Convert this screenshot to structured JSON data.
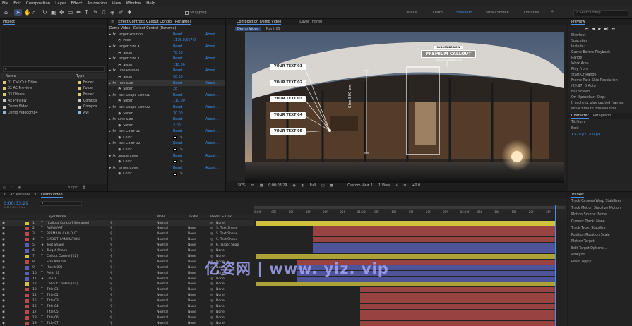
{
  "menu": [
    "File",
    "Edit",
    "Composition",
    "Layer",
    "Effect",
    "Animation",
    "View",
    "Window",
    "Help"
  ],
  "toolbar": {
    "snapping_label": "Snapping",
    "workspaces": [
      "Default",
      "Learn",
      "Standard",
      "Small Screen",
      "Libraries"
    ],
    "active_workspace": "Standard",
    "search_placeholder": "Search Help"
  },
  "project": {
    "tab": "Project",
    "columns": {
      "name": "Name",
      "type": "Type"
    },
    "items": [
      {
        "name": "01 Call Out Titles",
        "type": "Folder",
        "color": "#d9c77a"
      },
      {
        "name": "02 AE Preview",
        "type": "Folder",
        "color": "#d9c77a"
      },
      {
        "name": "03 Others",
        "type": "Folder",
        "color": "#d9c77a"
      },
      {
        "name": "AE Preview",
        "type": "Compos",
        "color": "#c8c8c8"
      },
      {
        "name": "Demo Video",
        "type": "Compos",
        "color": "#c8c8c8"
      },
      {
        "name": "Demo Videocmp4",
        "type": "AVI",
        "color": "#8fb5d6"
      }
    ],
    "footer_label": "8 bpc"
  },
  "effect_controls": {
    "tab": "Effect Controls: Callout Control (Rename)",
    "header": "Demo Video · Callout Control (Rename)",
    "rows": [
      {
        "n": "Target Position",
        "v": "Reset",
        "v2": "About..."
      },
      {
        "n": "Point",
        "v": "1176.0,567.0",
        "v2": ""
      },
      {
        "n": "Target Size X",
        "v": "Reset",
        "v2": "About..."
      },
      {
        "n": "Slider",
        "v": "78.00",
        "v2": ""
      },
      {
        "n": "Target Size Y",
        "v": "Reset",
        "v2": "About..."
      },
      {
        "n": "Slider",
        "v": "118.00",
        "v2": ""
      },
      {
        "n": "Title Position",
        "v": "Reset",
        "v2": "About..."
      },
      {
        "n": "Slider",
        "v": "50.00",
        "v2": ""
      },
      {
        "n": "Title Size",
        "v": "Reset",
        "v2": "About..."
      },
      {
        "n": "Slider",
        "v": "28",
        "v2": ""
      },
      {
        "n": "Text Shape Size 01",
        "v": "Reset",
        "v2": "About..."
      },
      {
        "n": "Slider",
        "v": "110.00",
        "v2": ""
      },
      {
        "n": "Text Shape Size 02",
        "v": "Reset",
        "v2": "About..."
      },
      {
        "n": "Slider",
        "v": "30.00",
        "v2": ""
      },
      {
        "n": "Line Size",
        "v": "Reset",
        "v2": "About..."
      },
      {
        "n": "Slider",
        "v": "3.00",
        "v2": ""
      },
      {
        "n": "Text Color 01",
        "v": "Reset",
        "v2": "About..."
      },
      {
        "n": "Color",
        "v": "",
        "v2": ""
      },
      {
        "n": "Text Color 02",
        "v": "Reset",
        "v2": "About..."
      },
      {
        "n": "Color",
        "v": "",
        "v2": ""
      },
      {
        "n": "Shape Color",
        "v": "Reset",
        "v2": "About..."
      },
      {
        "n": "Color",
        "v": "",
        "v2": ""
      },
      {
        "n": "Target Color",
        "v": "Reset",
        "v2": "About..."
      },
      {
        "n": "Color",
        "v": "",
        "v2": ""
      }
    ]
  },
  "composition": {
    "tab": "Composition Demo Video",
    "layer_tab": "Layer (none)",
    "crumbs": [
      "Demo Video",
      "Point 09"
    ],
    "callouts": [
      "YOUR TEXT 01",
      "YOUR TEXT 02",
      "YOUR TEXT 03",
      "YOUR TEXT 04",
      "YOUR TEXT 05"
    ],
    "premium": {
      "top": "SUBSCRIBE NOW",
      "main": "PREMIUM CALLOUT",
      "sub": "SMOOTH ANIMATION"
    },
    "size_label": "Size 800 cm",
    "footer": {
      "zoom": "50%",
      "timecode": "0;00;03;29",
      "res": "Full",
      "view": "Custom View 1",
      "views": "1 View",
      "exposure": "+0.0"
    }
  },
  "preview": {
    "tab": "Preview",
    "rows": [
      "Shortcut",
      "Spacebar",
      "Include:",
      "Cache Before Playback",
      "Range",
      "Work Area",
      "Play From",
      "Start Of Range",
      "Frame Rate  Skip  Resolution",
      "(29.97)  0  Auto",
      "Full Screen",
      "On (Spacebar) Stop:",
      "If caching, play cached frames",
      "Move time to preview time"
    ]
  },
  "character": {
    "tabs": [
      "Character",
      "Paragraph"
    ],
    "font": "Titillium",
    "style": "Bold",
    "size": "420 px",
    "leading": "200 px"
  },
  "tracker": {
    "tab": "Tracker",
    "rows": [
      "Track Camera   Warp Stabilizer",
      "Track Motion   Stabilize Motion",
      "Motion Source:  None",
      "Current Track:  None",
      "Track Type:  Stabilize",
      "Position   Rotation   Scale",
      "Motion Target:",
      "Edit Target   Options...",
      "Analyze:",
      "Reset   Apply"
    ]
  },
  "timeline": {
    "tabs": [
      "AE Preview",
      "Demo Video"
    ],
    "timecode": "0;00;03;29",
    "timecode_sub": "00119 (29.97 fps)",
    "columns": {
      "layer": "Layer Name",
      "mode": "Mode",
      "trkmat": "T TrkMat",
      "parent": "Parent & Link"
    },
    "ruler": [
      "0:00f",
      "05f",
      "10f",
      "15f",
      "20f",
      "25f",
      "01:00f",
      "05f",
      "10f",
      "15f",
      "20f",
      "25f",
      "02:00f",
      "05f",
      "10f",
      "15f",
      "20f",
      "25f"
    ],
    "layers": [
      {
        "i": "1",
        "name": "[Callout Control] (Rename)",
        "star": false,
        "color": "#d0c23a",
        "parent": "None",
        "mode": "Normal",
        "trk": ""
      },
      {
        "i": "2",
        "name": "AWAWAAT",
        "star": false,
        "color": "#b74a4a",
        "parent": "5. Text Shape",
        "mode": "Normal",
        "trk": "None"
      },
      {
        "i": "3",
        "name": "PREMIUM CALLOUT",
        "star": false,
        "color": "#b74a4a",
        "parent": "5. Text Shape",
        "mode": "Normal",
        "trk": "None"
      },
      {
        "i": "4",
        "name": "SMOOTH ANIMATION",
        "star": false,
        "color": "#b74a4a",
        "parent": "5. Text Shape",
        "mode": "Normal",
        "trk": "None"
      },
      {
        "i": "5",
        "name": "Text Shape",
        "star": true,
        "color": "#5a5fb5",
        "parent": "6. Target Shap",
        "mode": "Normal",
        "trk": "None"
      },
      {
        "i": "6",
        "name": "Target Shape",
        "star": true,
        "color": "#5a5fb5",
        "parent": "None",
        "mode": "Normal",
        "trk": "None"
      },
      {
        "i": "7",
        "name": "Callout Control [02]",
        "star": false,
        "color": "#d0c23a",
        "parent": "None",
        "mode": "Normal",
        "trk": "None"
      },
      {
        "i": "8",
        "name": "Size 800 cm",
        "star": false,
        "color": "#b74a4a",
        "parent": "None",
        "mode": "Normal",
        "trk": "None"
      },
      {
        "i": "9",
        "name": "[Point 09]",
        "star": false,
        "color": "#5a5fb5",
        "parent": "None",
        "mode": "Normal",
        "trk": "None"
      },
      {
        "i": "10",
        "name": "Point 02",
        "star": false,
        "color": "#5a5fb5",
        "parent": "None",
        "mode": "Normal",
        "trk": "None"
      },
      {
        "i": "11",
        "name": "Line 2",
        "star": true,
        "color": "#5a5fb5",
        "parent": "None",
        "mode": "Normal",
        "trk": "None"
      },
      {
        "i": "12",
        "name": "Callout Control [01]",
        "star": false,
        "color": "#d0c23a",
        "parent": "None",
        "mode": "Normal",
        "trk": "None"
      },
      {
        "i": "13",
        "name": "Title 01",
        "star": false,
        "color": "#b74a4a",
        "parent": "None",
        "mode": "Normal",
        "trk": "None"
      },
      {
        "i": "14",
        "name": "Title 02",
        "star": false,
        "color": "#b74a4a",
        "parent": "None",
        "mode": "Normal",
        "trk": "None"
      },
      {
        "i": "15",
        "name": "Title 03",
        "star": false,
        "color": "#b74a4a",
        "parent": "None",
        "mode": "Normal",
        "trk": "None"
      },
      {
        "i": "16",
        "name": "Title 04",
        "star": false,
        "color": "#b74a4a",
        "parent": "None",
        "mode": "Normal",
        "trk": "None"
      },
      {
        "i": "17",
        "name": "Title 05",
        "star": false,
        "color": "#b74a4a",
        "parent": "None",
        "mode": "Normal",
        "trk": "None"
      },
      {
        "i": "18",
        "name": "Title 06",
        "star": false,
        "color": "#b74a4a",
        "parent": "None",
        "mode": "Normal",
        "trk": "None"
      },
      {
        "i": "19",
        "name": "Title 07",
        "star": false,
        "color": "#b74a4a",
        "parent": "None",
        "mode": "Normal",
        "trk": "None"
      }
    ],
    "bar_fraction": [
      1,
      0.19,
      0.19,
      0.19,
      0.19,
      0.19,
      1,
      0.14,
      0.14,
      0.14,
      0.14,
      1,
      0.35,
      0.35,
      0.35,
      0.35,
      0.35,
      0.35,
      0.35
    ],
    "bar_offset": [
      0,
      0.19,
      0.19,
      0.19,
      0.19,
      0.19,
      0,
      0.14,
      0.14,
      0.14,
      0.14,
      0,
      0.35,
      0.35,
      0.35,
      0.35,
      0.35,
      0.35,
      0.35
    ]
  },
  "watermark": "亿姿网 | www. yiz. vip"
}
